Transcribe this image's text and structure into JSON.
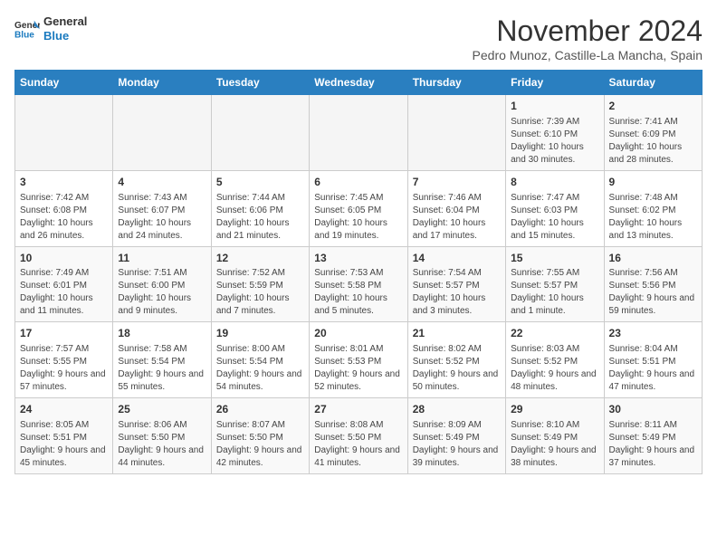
{
  "header": {
    "logo_general": "General",
    "logo_blue": "Blue",
    "month_year": "November 2024",
    "location": "Pedro Munoz, Castille-La Mancha, Spain"
  },
  "weekdays": [
    "Sunday",
    "Monday",
    "Tuesday",
    "Wednesday",
    "Thursday",
    "Friday",
    "Saturday"
  ],
  "weeks": [
    [
      {
        "day": "",
        "info": ""
      },
      {
        "day": "",
        "info": ""
      },
      {
        "day": "",
        "info": ""
      },
      {
        "day": "",
        "info": ""
      },
      {
        "day": "",
        "info": ""
      },
      {
        "day": "1",
        "info": "Sunrise: 7:39 AM\nSunset: 6:10 PM\nDaylight: 10 hours and 30 minutes."
      },
      {
        "day": "2",
        "info": "Sunrise: 7:41 AM\nSunset: 6:09 PM\nDaylight: 10 hours and 28 minutes."
      }
    ],
    [
      {
        "day": "3",
        "info": "Sunrise: 7:42 AM\nSunset: 6:08 PM\nDaylight: 10 hours and 26 minutes."
      },
      {
        "day": "4",
        "info": "Sunrise: 7:43 AM\nSunset: 6:07 PM\nDaylight: 10 hours and 24 minutes."
      },
      {
        "day": "5",
        "info": "Sunrise: 7:44 AM\nSunset: 6:06 PM\nDaylight: 10 hours and 21 minutes."
      },
      {
        "day": "6",
        "info": "Sunrise: 7:45 AM\nSunset: 6:05 PM\nDaylight: 10 hours and 19 minutes."
      },
      {
        "day": "7",
        "info": "Sunrise: 7:46 AM\nSunset: 6:04 PM\nDaylight: 10 hours and 17 minutes."
      },
      {
        "day": "8",
        "info": "Sunrise: 7:47 AM\nSunset: 6:03 PM\nDaylight: 10 hours and 15 minutes."
      },
      {
        "day": "9",
        "info": "Sunrise: 7:48 AM\nSunset: 6:02 PM\nDaylight: 10 hours and 13 minutes."
      }
    ],
    [
      {
        "day": "10",
        "info": "Sunrise: 7:49 AM\nSunset: 6:01 PM\nDaylight: 10 hours and 11 minutes."
      },
      {
        "day": "11",
        "info": "Sunrise: 7:51 AM\nSunset: 6:00 PM\nDaylight: 10 hours and 9 minutes."
      },
      {
        "day": "12",
        "info": "Sunrise: 7:52 AM\nSunset: 5:59 PM\nDaylight: 10 hours and 7 minutes."
      },
      {
        "day": "13",
        "info": "Sunrise: 7:53 AM\nSunset: 5:58 PM\nDaylight: 10 hours and 5 minutes."
      },
      {
        "day": "14",
        "info": "Sunrise: 7:54 AM\nSunset: 5:57 PM\nDaylight: 10 hours and 3 minutes."
      },
      {
        "day": "15",
        "info": "Sunrise: 7:55 AM\nSunset: 5:57 PM\nDaylight: 10 hours and 1 minute."
      },
      {
        "day": "16",
        "info": "Sunrise: 7:56 AM\nSunset: 5:56 PM\nDaylight: 9 hours and 59 minutes."
      }
    ],
    [
      {
        "day": "17",
        "info": "Sunrise: 7:57 AM\nSunset: 5:55 PM\nDaylight: 9 hours and 57 minutes."
      },
      {
        "day": "18",
        "info": "Sunrise: 7:58 AM\nSunset: 5:54 PM\nDaylight: 9 hours and 55 minutes."
      },
      {
        "day": "19",
        "info": "Sunrise: 8:00 AM\nSunset: 5:54 PM\nDaylight: 9 hours and 54 minutes."
      },
      {
        "day": "20",
        "info": "Sunrise: 8:01 AM\nSunset: 5:53 PM\nDaylight: 9 hours and 52 minutes."
      },
      {
        "day": "21",
        "info": "Sunrise: 8:02 AM\nSunset: 5:52 PM\nDaylight: 9 hours and 50 minutes."
      },
      {
        "day": "22",
        "info": "Sunrise: 8:03 AM\nSunset: 5:52 PM\nDaylight: 9 hours and 48 minutes."
      },
      {
        "day": "23",
        "info": "Sunrise: 8:04 AM\nSunset: 5:51 PM\nDaylight: 9 hours and 47 minutes."
      }
    ],
    [
      {
        "day": "24",
        "info": "Sunrise: 8:05 AM\nSunset: 5:51 PM\nDaylight: 9 hours and 45 minutes."
      },
      {
        "day": "25",
        "info": "Sunrise: 8:06 AM\nSunset: 5:50 PM\nDaylight: 9 hours and 44 minutes."
      },
      {
        "day": "26",
        "info": "Sunrise: 8:07 AM\nSunset: 5:50 PM\nDaylight: 9 hours and 42 minutes."
      },
      {
        "day": "27",
        "info": "Sunrise: 8:08 AM\nSunset: 5:50 PM\nDaylight: 9 hours and 41 minutes."
      },
      {
        "day": "28",
        "info": "Sunrise: 8:09 AM\nSunset: 5:49 PM\nDaylight: 9 hours and 39 minutes."
      },
      {
        "day": "29",
        "info": "Sunrise: 8:10 AM\nSunset: 5:49 PM\nDaylight: 9 hours and 38 minutes."
      },
      {
        "day": "30",
        "info": "Sunrise: 8:11 AM\nSunset: 5:49 PM\nDaylight: 9 hours and 37 minutes."
      }
    ]
  ]
}
